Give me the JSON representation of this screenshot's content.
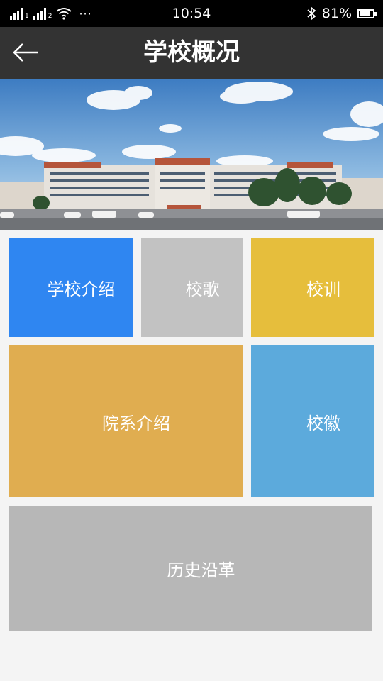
{
  "status_bar": {
    "sim1_label": "1",
    "sim2_label": "2",
    "more": "···",
    "time": "10:54",
    "battery_text": "81%",
    "battery_level": 0.81
  },
  "header": {
    "title": "学校概况"
  },
  "tiles": {
    "school_intro": {
      "label": "学校介绍",
      "color": "#2f86f1"
    },
    "school_song": {
      "label": "校歌",
      "color": "#c2c2c2"
    },
    "school_motto": {
      "label": "校训",
      "color": "#e6be3c"
    },
    "departments": {
      "label": "院系介绍",
      "color": "#e0ad50"
    },
    "school_badge": {
      "label": "校徽",
      "color": "#5caadc"
    },
    "history": {
      "label": "历史沿革",
      "color": "#b7b7b7"
    }
  },
  "colors": {
    "nav_background": "#333333",
    "page_background": "#f4f4f4"
  }
}
